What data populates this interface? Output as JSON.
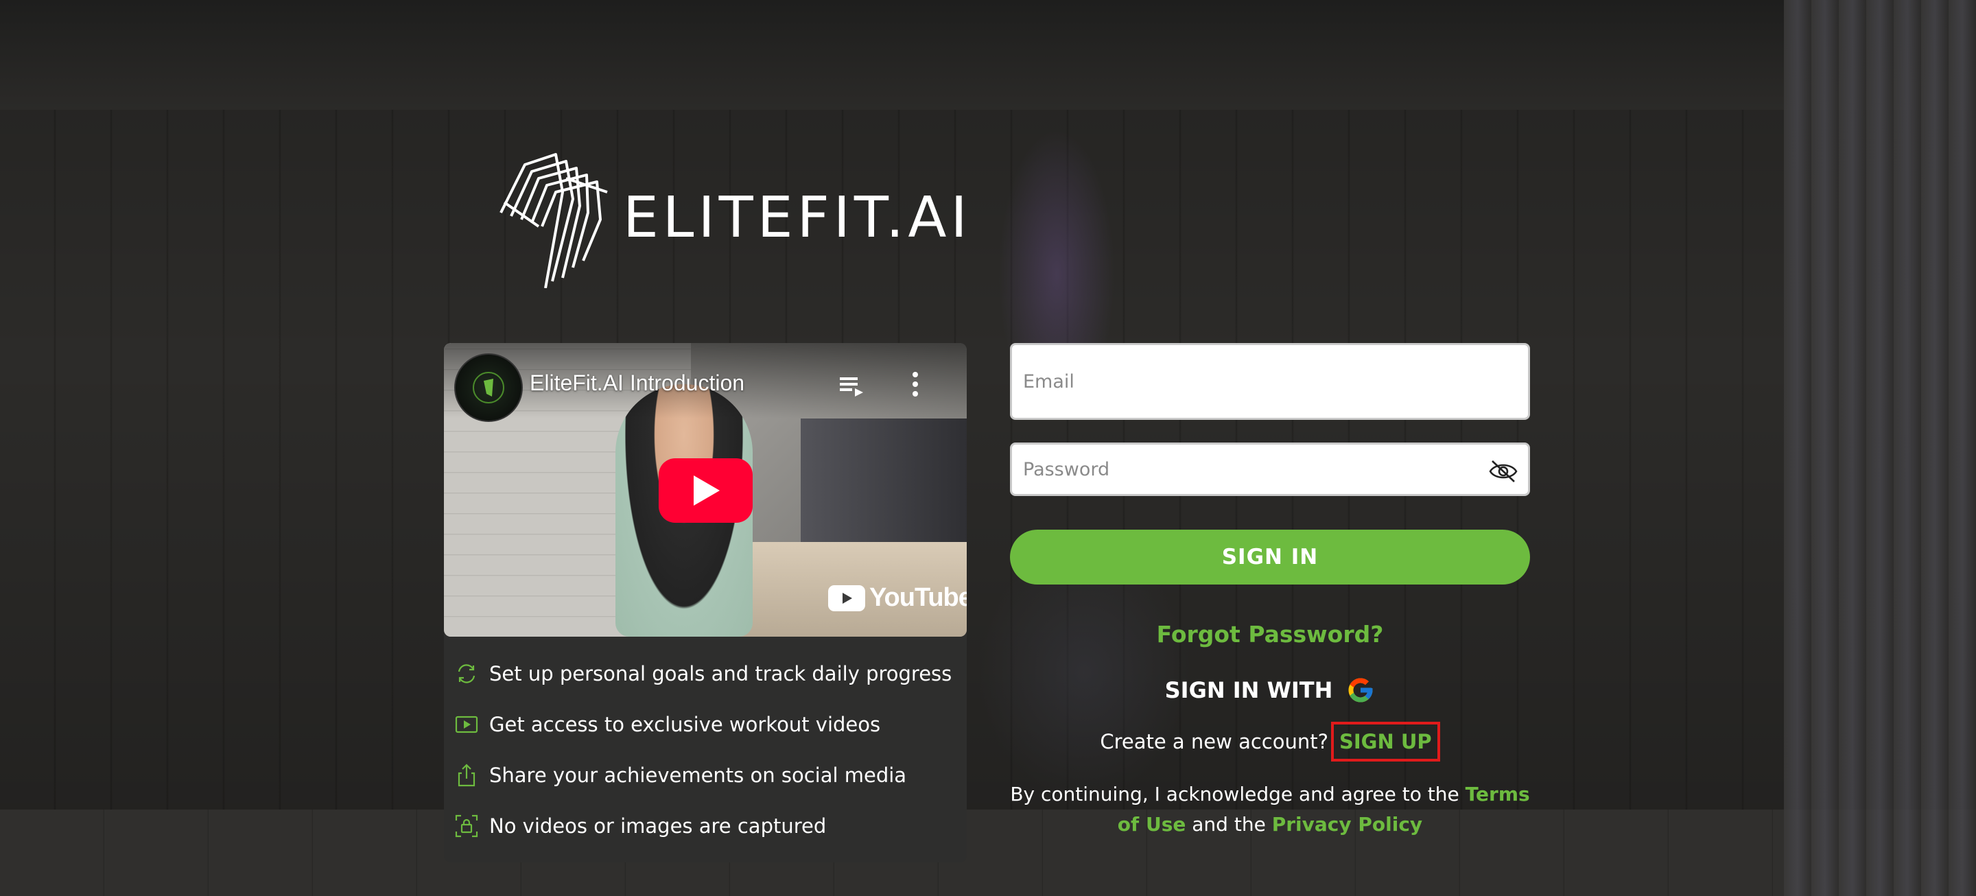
{
  "brand": {
    "name": "ELITEFIT.AI",
    "accent_color": "#6dbb3f"
  },
  "video": {
    "title": "EliteFit.AI Introduction",
    "platform": "YouTube",
    "icons": {
      "playlist": "playlist-icon",
      "more": "more-vert-icon",
      "play": "play-icon"
    }
  },
  "features": [
    {
      "icon": "refresh-icon",
      "text": "Set up personal goals and track daily progress"
    },
    {
      "icon": "video-icon",
      "text": "Get access to exclusive workout videos"
    },
    {
      "icon": "share-icon",
      "text": "Share your achievements on social media"
    },
    {
      "icon": "privacy-icon",
      "text": "No videos or images are captured"
    }
  ],
  "form": {
    "email_placeholder": "Email",
    "password_placeholder": "Password",
    "signin_label": "SIGN IN",
    "forgot_label": "Forgot Password?",
    "signin_with_label": "SIGN IN WITH",
    "create_account_text": "Create a new account?",
    "signup_label": "SIGN UP"
  },
  "legal": {
    "prefix": "By continuing, I acknowledge and agree to the ",
    "terms_label": "Terms of Use",
    "middle": " and the ",
    "privacy_label": "Privacy Policy"
  }
}
